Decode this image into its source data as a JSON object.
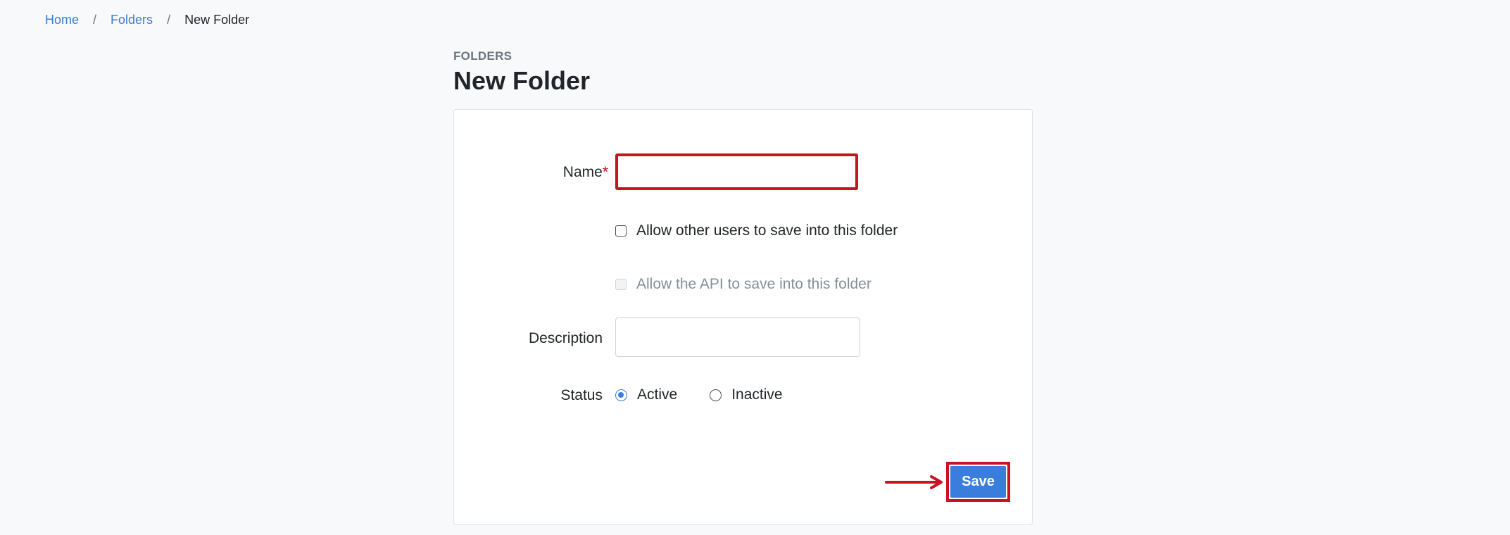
{
  "breadcrumb": {
    "items": [
      {
        "label": "Home"
      },
      {
        "label": "Folders"
      },
      {
        "label": "New Folder"
      }
    ],
    "separator": "/"
  },
  "header": {
    "eyebrow": "FOLDERS",
    "title": "New Folder"
  },
  "form": {
    "name": {
      "label": "Name",
      "required_marker": "*",
      "value": ""
    },
    "allow_users": {
      "label": "Allow other users to save into this folder",
      "checked": false
    },
    "allow_api": {
      "label": "Allow the API to save into this folder",
      "checked": false,
      "disabled": true
    },
    "description": {
      "label": "Description",
      "value": ""
    },
    "status": {
      "label": "Status",
      "options": [
        {
          "label": "Active",
          "selected": true
        },
        {
          "label": "Inactive",
          "selected": false
        }
      ]
    },
    "save_label": "Save"
  },
  "colors": {
    "accent": "#3b7ddd",
    "highlight": "#cc1122",
    "link": "#3d7ccb"
  },
  "icons": {
    "annotation_arrow": "arrow-right-icon"
  }
}
